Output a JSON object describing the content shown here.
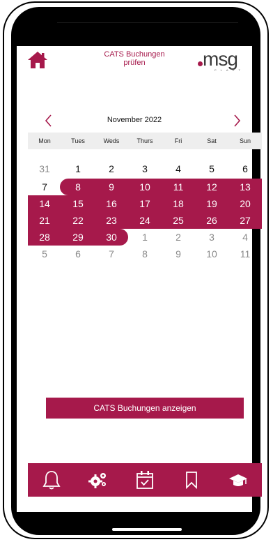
{
  "header": {
    "title_line1": "CATS Buchungen",
    "title_line2": "prüfen",
    "logo_text": "msg",
    "logo_sub": "PLAUT"
  },
  "calendar": {
    "month_label": "November 2022",
    "weekdays": [
      "Mon",
      "Tues",
      "Weds",
      "Thurs",
      "Fri",
      "Sat",
      "Sun"
    ],
    "rows": [
      [
        {
          "d": "31",
          "state": "out"
        },
        {
          "d": "1",
          "state": "in"
        },
        {
          "d": "2",
          "state": "in"
        },
        {
          "d": "3",
          "state": "in"
        },
        {
          "d": "4",
          "state": "in"
        },
        {
          "d": "5",
          "state": "in"
        },
        {
          "d": "6",
          "state": "in"
        }
      ],
      [
        {
          "d": "7",
          "state": "in"
        },
        {
          "d": "8",
          "state": "sel"
        },
        {
          "d": "9",
          "state": "sel"
        },
        {
          "d": "10",
          "state": "sel"
        },
        {
          "d": "11",
          "state": "sel"
        },
        {
          "d": "12",
          "state": "sel"
        },
        {
          "d": "13",
          "state": "sel"
        }
      ],
      [
        {
          "d": "14",
          "state": "sel"
        },
        {
          "d": "15",
          "state": "sel"
        },
        {
          "d": "16",
          "state": "sel"
        },
        {
          "d": "17",
          "state": "sel"
        },
        {
          "d": "18",
          "state": "sel"
        },
        {
          "d": "19",
          "state": "sel"
        },
        {
          "d": "20",
          "state": "sel"
        }
      ],
      [
        {
          "d": "21",
          "state": "sel"
        },
        {
          "d": "22",
          "state": "sel"
        },
        {
          "d": "23",
          "state": "sel"
        },
        {
          "d": "24",
          "state": "sel"
        },
        {
          "d": "25",
          "state": "sel"
        },
        {
          "d": "26",
          "state": "sel"
        },
        {
          "d": "27",
          "state": "sel"
        }
      ],
      [
        {
          "d": "28",
          "state": "sel"
        },
        {
          "d": "29",
          "state": "sel"
        },
        {
          "d": "30",
          "state": "sel"
        },
        {
          "d": "1",
          "state": "out"
        },
        {
          "d": "2",
          "state": "out"
        },
        {
          "d": "3",
          "state": "out"
        },
        {
          "d": "4",
          "state": "out"
        }
      ],
      [
        {
          "d": "5",
          "state": "out"
        },
        {
          "d": "6",
          "state": "out"
        },
        {
          "d": "7",
          "state": "out"
        },
        {
          "d": "8",
          "state": "out"
        },
        {
          "d": "9",
          "state": "out"
        },
        {
          "d": "10",
          "state": "out"
        },
        {
          "d": "11",
          "state": "out"
        }
      ]
    ]
  },
  "action": {
    "label": "CATS Buchungen anzeigen"
  },
  "tabs": [
    {
      "icon": "bell-icon"
    },
    {
      "icon": "gears-icon"
    },
    {
      "icon": "calendar-check-icon"
    },
    {
      "icon": "bookmark-icon"
    },
    {
      "icon": "graduation-cap-icon"
    }
  ],
  "colors": {
    "accent": "#a6194b",
    "weekday_bg": "#eeeeee"
  }
}
